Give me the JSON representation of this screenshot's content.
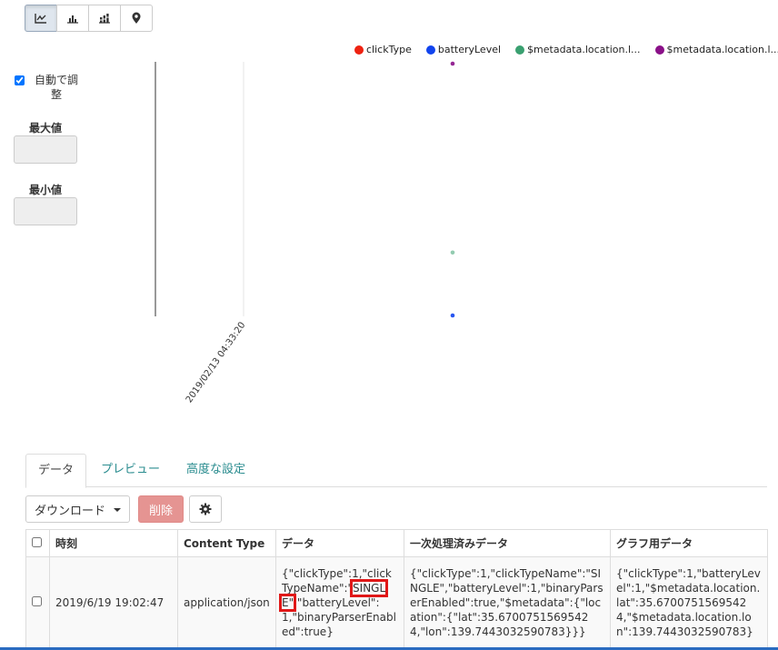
{
  "toolbar": {
    "buttons": [
      {
        "icon": "line-chart-icon",
        "active": true
      },
      {
        "icon": "bar-chart-icon",
        "active": false
      },
      {
        "icon": "stacked-bar-chart-icon",
        "active": false
      },
      {
        "icon": "map-marker-icon",
        "active": false
      }
    ]
  },
  "legend": [
    {
      "label": "clickType",
      "color": "#ee2211"
    },
    {
      "label": "batteryLevel",
      "color": "#1144ee"
    },
    {
      "label": "$metadata.location.l...",
      "color": "#3aa070"
    },
    {
      "label": "$metadata.location.l...",
      "color": "#8a1088"
    }
  ],
  "controls": {
    "autoscale_label": "自動で調整",
    "autoscale_checked": true,
    "max_label": "最大値",
    "min_label": "最小値",
    "max_value": "",
    "min_value": ""
  },
  "chart_data": {
    "type": "scatter",
    "x_tick_label": "2019/02/13 04:33:20",
    "series": [
      {
        "name": "clickType",
        "color": "#ee2211",
        "points": []
      },
      {
        "name": "batteryLevel",
        "color": "#1144ee",
        "points": [
          {
            "y_level": 0.0
          }
        ]
      },
      {
        "name": "$metadata.location.l...",
        "color": "#3aa070",
        "points": [
          {
            "y_level": 0.25
          }
        ]
      },
      {
        "name": "$metadata.location.l...",
        "color": "#8a1088",
        "points": [
          {
            "y_level": 1.0
          }
        ]
      }
    ]
  },
  "tabs": [
    {
      "label": "データ",
      "active": true
    },
    {
      "label": "プレビュー",
      "active": false
    },
    {
      "label": "高度な設定",
      "active": false
    }
  ],
  "actions": {
    "download_label": "ダウンロード",
    "delete_label": "削除",
    "settings_icon": "gear-icon"
  },
  "table": {
    "headers": [
      "時刻",
      "Content Type",
      "データ",
      "一次処理済みデータ",
      "グラフ用データ"
    ],
    "rows": [
      {
        "time": "2019/6/19 19:02:47",
        "content_type": "application/json",
        "data_before": "{\"clickType\":1,\"clickTypeName\":\"",
        "data_highlight": "SINGLE\"",
        "data_after": ",\"batteryLevel\":1,\"binaryParserEnabled\":true}",
        "processed": "{\"clickType\":1,\"clickTypeName\":\"SINGLE\",\"batteryLevel\":1,\"binaryParserEnabled\":true,\"$metadata\":{\"location\":{\"lat\":35.67007515695424,\"lon\":139.7443032590783}}}",
        "graph": "{\"clickType\":1,\"batteryLevel\":1,\"$metadata.location.lat\":35.67007515695424,\"$metadata.location.lon\":139.7443032590783}"
      }
    ]
  }
}
